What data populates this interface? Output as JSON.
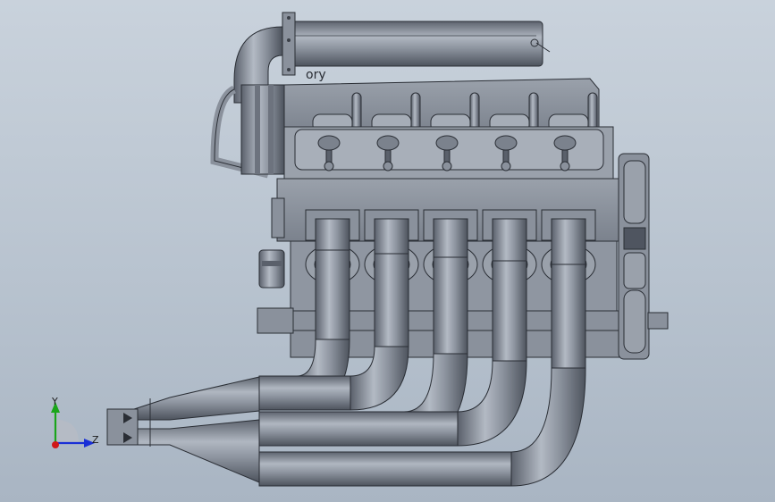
{
  "model": {
    "name": "engine-assembly",
    "valve_cover_text": "ory",
    "cylinders": 5
  },
  "triad": {
    "y_label": "Y",
    "z_label": "Z",
    "colors": {
      "y": "#1aa51a",
      "z": "#1a2fd6",
      "origin": "#d01818"
    }
  },
  "colors": {
    "background_top": "#c9d2dc",
    "background_bottom": "#a9b5c3",
    "metal": "#8a919c",
    "metal_light": "#b3bac4",
    "metal_dark": "#4f5560",
    "edge": "#2a2e35"
  }
}
